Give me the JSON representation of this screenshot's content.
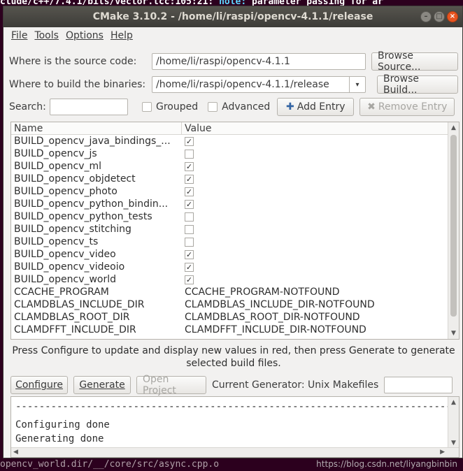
{
  "terminal": {
    "top_text": "clude/c++/7.4.1/bits/vector.tcc:105:21: ",
    "top_note": "note:",
    "top_rest": " parameter passing for ar",
    "bottom_text": "opencv_world.dir/__/core/src/async.cpp.o",
    "watermark": "https://blog.csdn.net/liyangbinbin"
  },
  "window": {
    "title": "CMake 3.10.2 - /home/li/raspi/opencv-4.1.1/release",
    "controls": [
      "–",
      "□",
      "×"
    ]
  },
  "menu": [
    "File",
    "Tools",
    "Options",
    "Help"
  ],
  "source": {
    "label": "Where is the source code:",
    "value": "/home/li/raspi/opencv-4.1.1",
    "browse_label": "Browse Source..."
  },
  "build": {
    "label": "Where to build the binaries:",
    "value": "/home/li/raspi/opencv-4.1.1/release",
    "browse_label": "Browse Build..."
  },
  "search": {
    "label": "Search:",
    "value": "",
    "grouped_label": "Grouped",
    "advanced_label": "Advanced",
    "add_entry_label": "Add Entry",
    "remove_entry_label": "Remove Entry"
  },
  "table": {
    "columns": [
      "Name",
      "Value"
    ],
    "rows": [
      {
        "name": "BUILD_opencv_java_bindings_...",
        "type": "bool",
        "checked": true
      },
      {
        "name": "BUILD_opencv_js",
        "type": "bool",
        "checked": false
      },
      {
        "name": "BUILD_opencv_ml",
        "type": "bool",
        "checked": true
      },
      {
        "name": "BUILD_opencv_objdetect",
        "type": "bool",
        "checked": true
      },
      {
        "name": "BUILD_opencv_photo",
        "type": "bool",
        "checked": true
      },
      {
        "name": "BUILD_opencv_python_bindin...",
        "type": "bool",
        "checked": true
      },
      {
        "name": "BUILD_opencv_python_tests",
        "type": "bool",
        "checked": false
      },
      {
        "name": "BUILD_opencv_stitching",
        "type": "bool",
        "checked": false
      },
      {
        "name": "BUILD_opencv_ts",
        "type": "bool",
        "checked": false
      },
      {
        "name": "BUILD_opencv_video",
        "type": "bool",
        "checked": true
      },
      {
        "name": "BUILD_opencv_videoio",
        "type": "bool",
        "checked": true
      },
      {
        "name": "BUILD_opencv_world",
        "type": "bool",
        "checked": true
      },
      {
        "name": "CCACHE_PROGRAM",
        "type": "text",
        "value": "CCACHE_PROGRAM-NOTFOUND"
      },
      {
        "name": "CLAMDBLAS_INCLUDE_DIR",
        "type": "text",
        "value": "CLAMDBLAS_INCLUDE_DIR-NOTFOUND"
      },
      {
        "name": "CLAMDBLAS_ROOT_DIR",
        "type": "text",
        "value": "CLAMDBLAS_ROOT_DIR-NOTFOUND"
      },
      {
        "name": "CLAMDFFT_INCLUDE_DIR",
        "type": "text",
        "value": "CLAMDFFT_INCLUDE_DIR-NOTFOUND"
      }
    ]
  },
  "hint": "Press Configure to update and display new values in red, then press Generate to generate selected build files.",
  "actions": {
    "configure_label": "Configure",
    "generate_label": "Generate",
    "open_project_label": "Open Project",
    "generator_label": "Current Generator: Unix Makefiles"
  },
  "output": {
    "dashes": "--------------------------------------------------------------------------------",
    "lines": [
      "Configuring done",
      "Generating done"
    ]
  },
  "colors": {
    "accent": "#e95420",
    "plus_icon": "#3465a4"
  }
}
